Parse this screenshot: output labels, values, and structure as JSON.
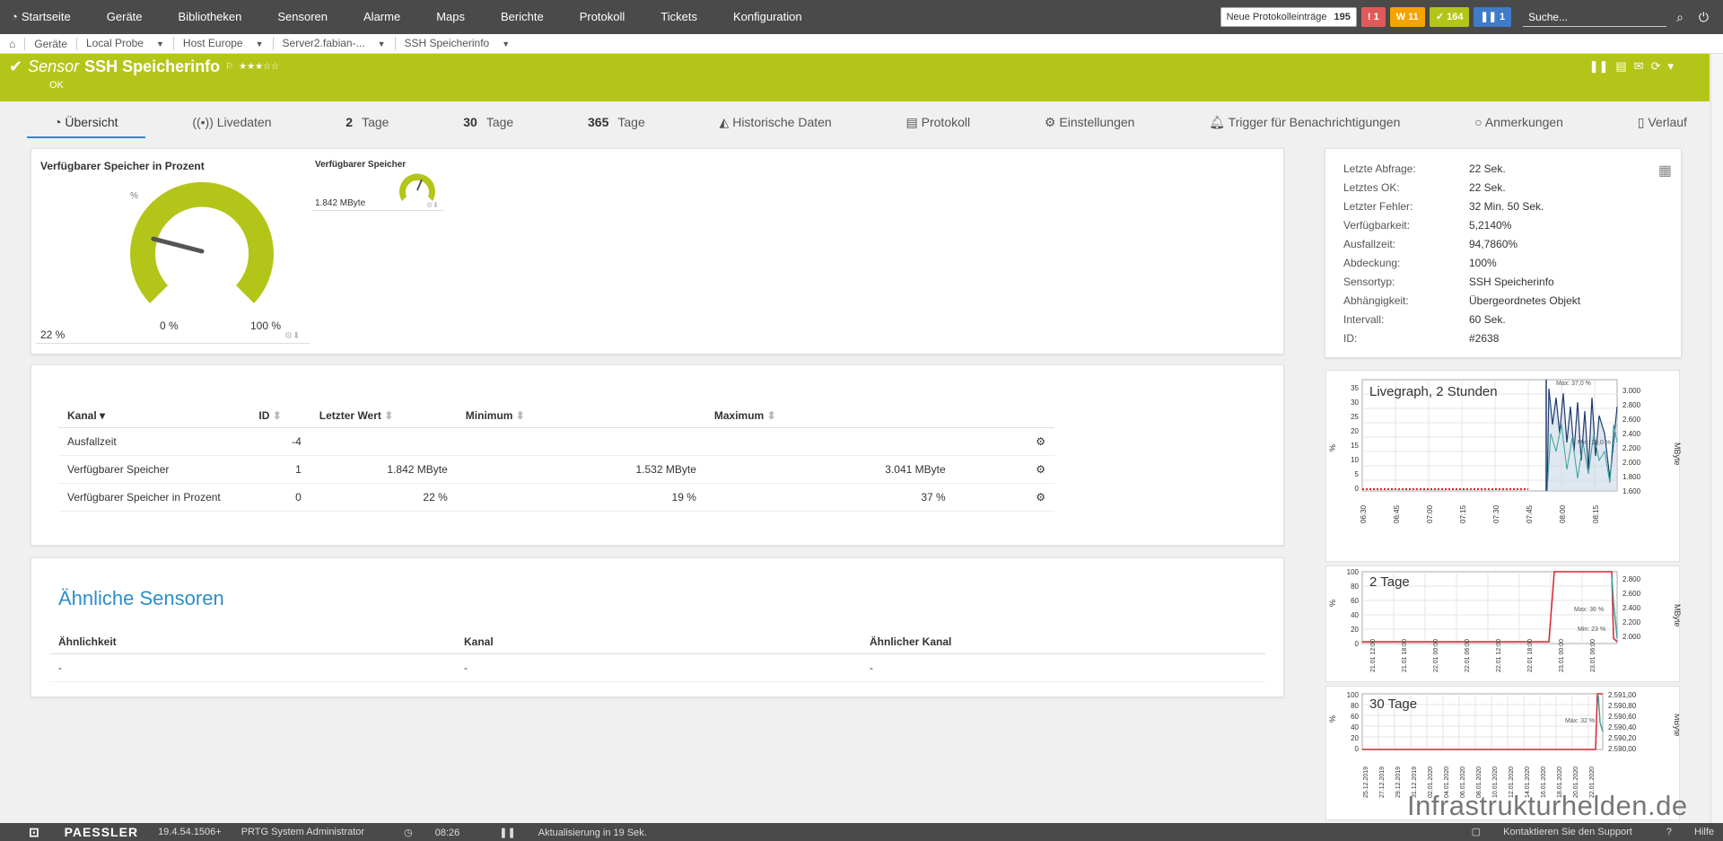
{
  "nav": {
    "home": "Startseite",
    "items": [
      "Geräte",
      "Bibliotheken",
      "Sensoren",
      "Alarme",
      "Maps",
      "Berichte",
      "Protokoll",
      "Tickets",
      "Konfiguration"
    ],
    "new_log_label": "Neue Protokolleinträge",
    "new_log_count": "195",
    "badges": {
      "error": "1",
      "warning": "11",
      "ok": "164",
      "paused": "1"
    },
    "search_placeholder": "Suche..."
  },
  "breadcrumbs": [
    "Geräte",
    "Local Probe",
    "Host Europe",
    "Server2.fabian-...",
    "SSH Speicherinfo"
  ],
  "header": {
    "prefix": "Sensor",
    "name": "SSH Speicherinfo",
    "stars": "★★★☆☆",
    "status": "OK"
  },
  "tabs": [
    {
      "label": "Übersicht",
      "num": ""
    },
    {
      "label": "Livedaten",
      "num": ""
    },
    {
      "label": "Tage",
      "num": "2"
    },
    {
      "label": "Tage",
      "num": "30"
    },
    {
      "label": "Tage",
      "num": "365"
    },
    {
      "label": "Historische Daten",
      "num": ""
    },
    {
      "label": "Protokoll",
      "num": ""
    },
    {
      "label": "Einstellungen",
      "num": ""
    },
    {
      "label": "Trigger für Benachrichtigungen",
      "num": ""
    },
    {
      "label": "Anmerkungen",
      "num": ""
    },
    {
      "label": "Verlauf",
      "num": ""
    }
  ],
  "gauge_main": {
    "title": "Verfügbarer Speicher in Prozent",
    "value": "22 %",
    "min": "0 %",
    "max": "100 %",
    "unit": "%",
    "fraction": 0.22
  },
  "gauge_small": {
    "title": "Verfügbarer Speicher",
    "value": "1.842 MByte"
  },
  "info": [
    {
      "k": "Letzte Abfrage:",
      "v": "22 Sek."
    },
    {
      "k": "Letztes OK:",
      "v": "22 Sek."
    },
    {
      "k": "Letzter Fehler:",
      "v": "32 Min. 50 Sek."
    },
    {
      "k": "Verfügbarkeit:",
      "v": "5,2140%"
    },
    {
      "k": "Ausfallzeit:",
      "v": "94,7860%"
    },
    {
      "k": "Abdeckung:",
      "v": "100%"
    },
    {
      "k": "Sensortyp:",
      "v": "SSH Speicherinfo"
    },
    {
      "k": "Abhängigkeit:",
      "v": "Übergeordnetes Objekt"
    },
    {
      "k": "Intervall:",
      "v": "60 Sek."
    },
    {
      "k": "ID:",
      "v": "#2638"
    }
  ],
  "channels": {
    "headers": {
      "kanal": "Kanal",
      "id": "ID",
      "last": "Letzter Wert",
      "min": "Minimum",
      "max": "Maximum"
    },
    "rows": [
      {
        "name": "Ausfallzeit",
        "id": "-4",
        "last": "",
        "min": "",
        "max": ""
      },
      {
        "name": "Verfügbarer Speicher",
        "id": "1",
        "last": "1.842 MByte",
        "min": "1.532 MByte",
        "max": "3.041 MByte"
      },
      {
        "name": "Verfügbarer Speicher in Prozent",
        "id": "0",
        "last": "22 %",
        "min": "19 %",
        "max": "37 %"
      }
    ]
  },
  "similar": {
    "title": "Ähnliche Sensoren",
    "headers": [
      "Ähnlichkeit",
      "Kanal",
      "Ähnlicher Kanal"
    ],
    "row": [
      "-",
      "-",
      "-"
    ]
  },
  "graphs": [
    {
      "title": "Livegraph, 2 Stunden",
      "ylabel_left": "%",
      "ylabel_right": "MByte",
      "yticks_left": [
        "35",
        "30",
        "25",
        "20",
        "15",
        "10",
        "5",
        "0"
      ],
      "yticks_right": [
        "3.000",
        "2.800",
        "2.600",
        "2.400",
        "2.200",
        "2.000",
        "1.800",
        "1.600"
      ],
      "xticks": [
        "06:30",
        "06:45",
        "07:00",
        "07:15",
        "07:30",
        "07:45",
        "08:00",
        "08:15"
      ],
      "max_label": "Max: 37,0 %",
      "min_label": "Min: 19,0 %"
    },
    {
      "title": "2 Tage",
      "ylabel_left": "%",
      "ylabel_right": "MByte",
      "yticks_left": [
        "100",
        "80",
        "60",
        "40",
        "20",
        "0"
      ],
      "yticks_right": [
        "2.800",
        "2.600",
        "2.400",
        "2.200",
        "2.000"
      ],
      "xticks": [
        "21.01 12:00",
        "21.01 18:00",
        "22.01 00:00",
        "22.01 06:00",
        "22.01 12:00",
        "22.01 18:00",
        "23.01 00:00",
        "23.01 06:00"
      ],
      "max_label": "Max: 36 %",
      "min_label": "Min: 23 %"
    },
    {
      "title": "30 Tage",
      "ylabel_left": "%",
      "ylabel_right": "MByte",
      "yticks_left": [
        "100",
        "80",
        "60",
        "40",
        "20",
        "0"
      ],
      "yticks_right": [
        "2.591,00",
        "2.590,80",
        "2.590,60",
        "2.590,40",
        "2.590,20",
        "2.590,00"
      ],
      "xticks": [
        "25.12.2019",
        "27.12.2019",
        "29.12.2019",
        "31.12.2019",
        "02.01.2020",
        "04.01.2020",
        "06.01.2020",
        "08.01.2020",
        "10.01.2020",
        "12.01.2020",
        "14.01.2020",
        "16.01.2020",
        "18.01.2020",
        "20.01.2020",
        "22.01.2020"
      ],
      "max_label": "Max: 32 %",
      "min_label": ""
    }
  ],
  "footer": {
    "logo": "PAESSLER",
    "version": "19.4.54.1506+",
    "user": "PRTG System Administrator",
    "time": "08:26",
    "refresh": "Aktualisierung in 19 Sek.",
    "support": "Kontaktieren Sie den Support",
    "help": "Hilfe"
  },
  "watermark": "Infrastrukturhelden.de",
  "colors": {
    "accent": "#b4c51a",
    "nav": "#4a4a4a",
    "link": "#2a8fc9",
    "series_red": "#d9232e",
    "series_dark": "#1f3a6e",
    "series_teal": "#3aa39a"
  }
}
